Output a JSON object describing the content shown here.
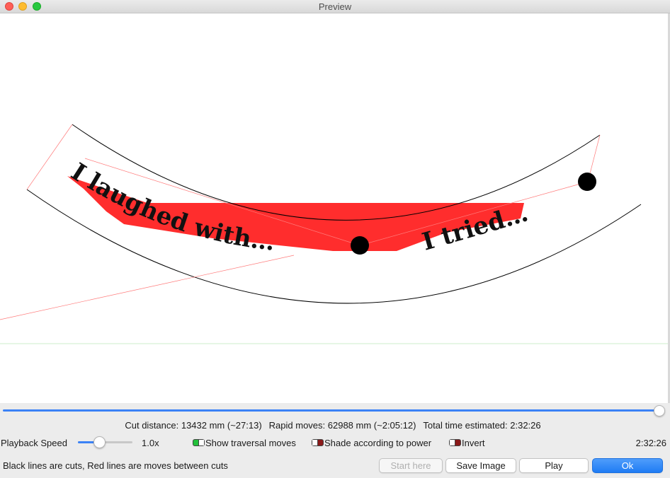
{
  "window": {
    "title": "Preview"
  },
  "preview": {
    "cut_texts": [
      "I laughed with…",
      "I tried…"
    ],
    "colors": {
      "cut_line": "#000000",
      "move_line": "#ff6b6b",
      "fill": "#ff2d2d",
      "baseline": "#cdeecb"
    }
  },
  "playback": {
    "progress": 1.0,
    "speed_fraction": 0.4
  },
  "stats": {
    "cut_distance": "Cut distance: 13432 mm (~27:13)",
    "rapid_moves": "Rapid moves: 62988 mm (~2:05:12)",
    "total_time": "Total time estimated: 2:32:26"
  },
  "controls": {
    "playback_speed_label": "Playback Speed",
    "speed_value": "1.0x",
    "show_traversal": {
      "label": "Show traversal moves",
      "on": true,
      "color": "#22c03a"
    },
    "shade_power": {
      "label": "Shade according to power",
      "on": true,
      "color": "#8b1a1a"
    },
    "invert": {
      "label": "Invert",
      "on": true,
      "color": "#8b1a1a"
    },
    "elapsed": "2:32:26"
  },
  "footer": {
    "legend": "Black lines are cuts, Red lines are moves between cuts",
    "start_here": "Start here",
    "save_image": "Save Image",
    "play": "Play",
    "ok": "Ok"
  }
}
